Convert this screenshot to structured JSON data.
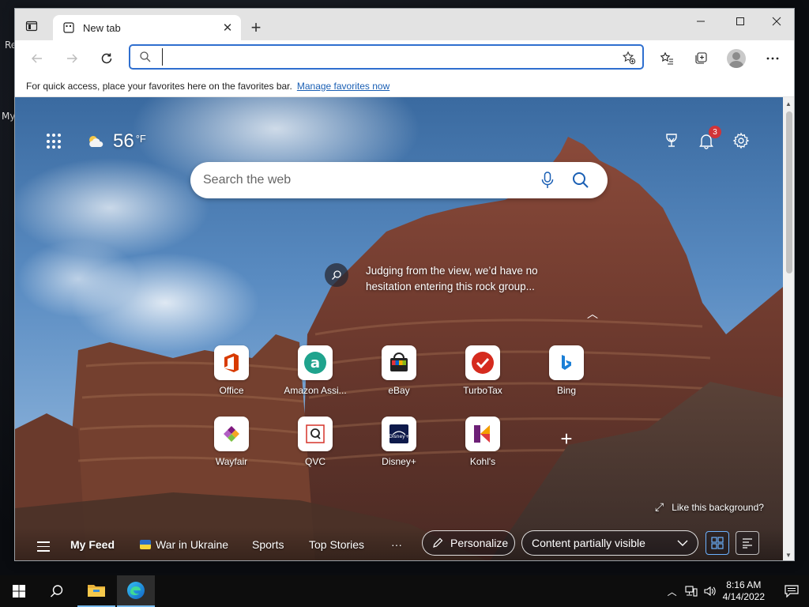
{
  "desktop": {
    "label_1": "Re",
    "label_2": "My"
  },
  "browser": {
    "tab": {
      "title": "New tab",
      "close": "✕"
    },
    "new_tab": "+",
    "address_bar": {
      "value": "",
      "placeholder": ""
    },
    "favorites_bar": {
      "message": "For quick access, place your favorites here on the favorites bar.",
      "link": "Manage favorites now"
    }
  },
  "ntp": {
    "weather": {
      "temperature": "56",
      "unit": "°F"
    },
    "notifications_count": "3",
    "search": {
      "placeholder": "Search the web",
      "value": ""
    },
    "background_caption": "Judging from the view, we’d have no hesitation entering this rock group...",
    "quick_links": [
      {
        "label": "Office",
        "icon": "office-icon"
      },
      {
        "label": "Amazon Assi...",
        "icon": "amazon-assistant-icon"
      },
      {
        "label": "eBay",
        "icon": "ebay-icon"
      },
      {
        "label": "TurboTax",
        "icon": "turbotax-icon"
      },
      {
        "label": "Bing",
        "icon": "bing-icon"
      },
      {
        "label": "Wayfair",
        "icon": "wayfair-icon"
      },
      {
        "label": "QVC",
        "icon": "qvc-icon"
      },
      {
        "label": "Disney+",
        "icon": "disney-plus-icon"
      },
      {
        "label": "Kohl's",
        "icon": "kohls-icon"
      }
    ],
    "add_site": "+",
    "like_background": "Like this background?",
    "feed": {
      "tabs": [
        "My Feed",
        "War in Ukraine",
        "Sports",
        "Top Stories"
      ],
      "more": "···",
      "personalize": "Personalize",
      "content_visibility": "Content partially visible"
    }
  },
  "taskbar": {
    "clock": {
      "time": "8:16 AM",
      "date": "4/14/2022"
    }
  },
  "colors": {
    "accent": "#2f6fcf",
    "badge": "#d13438",
    "taskbar": "#0d0d0d"
  }
}
